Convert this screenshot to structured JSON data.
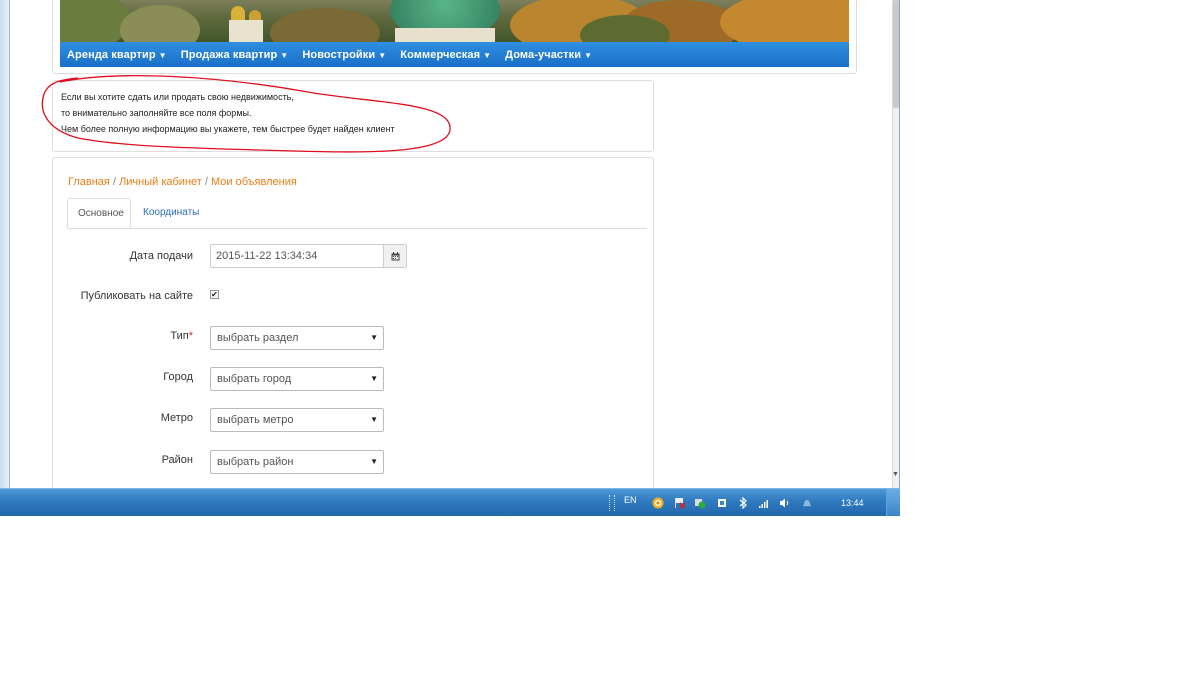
{
  "nav": {
    "items": [
      {
        "label": "Аренда квартир"
      },
      {
        "label": "Продажа квартир"
      },
      {
        "label": "Новостройки"
      },
      {
        "label": "Коммерческая"
      },
      {
        "label": "Дома-участки"
      }
    ],
    "caret": "▼"
  },
  "info": {
    "line1": "Если вы хотите сдать или продать свою недвижимость,",
    "line2": "то внимательно заполняйте все поля формы.",
    "line3": "Чем более полную информацию вы укажете, тем быстрее будет найден клиент",
    "highlight_color": "#e0101e"
  },
  "breadcrumb": {
    "home": "Главная",
    "cabinet": "Личный кабинет",
    "ads": "Мои объявления",
    "sep": "/"
  },
  "tabs": {
    "main": "Основное",
    "coords": "Координаты"
  },
  "form": {
    "date_label": "Дата подачи",
    "date_value": "2015-11-22 13:34:34",
    "publish_label": "Публиковать на сайте",
    "publish_checked": true,
    "type_label": "Тип",
    "required_mark": "*",
    "type_placeholder": "выбрать раздел",
    "city_label": "Город",
    "city_placeholder": "выбрать город",
    "metro_label": "Метро",
    "metro_placeholder": "выбрать метро",
    "district_label": "Район",
    "district_placeholder": "выбрать район"
  },
  "taskbar": {
    "language": "EN",
    "clock": "13:44"
  },
  "colors": {
    "nav_blue": "#1a6fc8",
    "link_orange": "#e87e17",
    "tab_blue": "#2a6ebb",
    "required_red": "#d9262c"
  }
}
